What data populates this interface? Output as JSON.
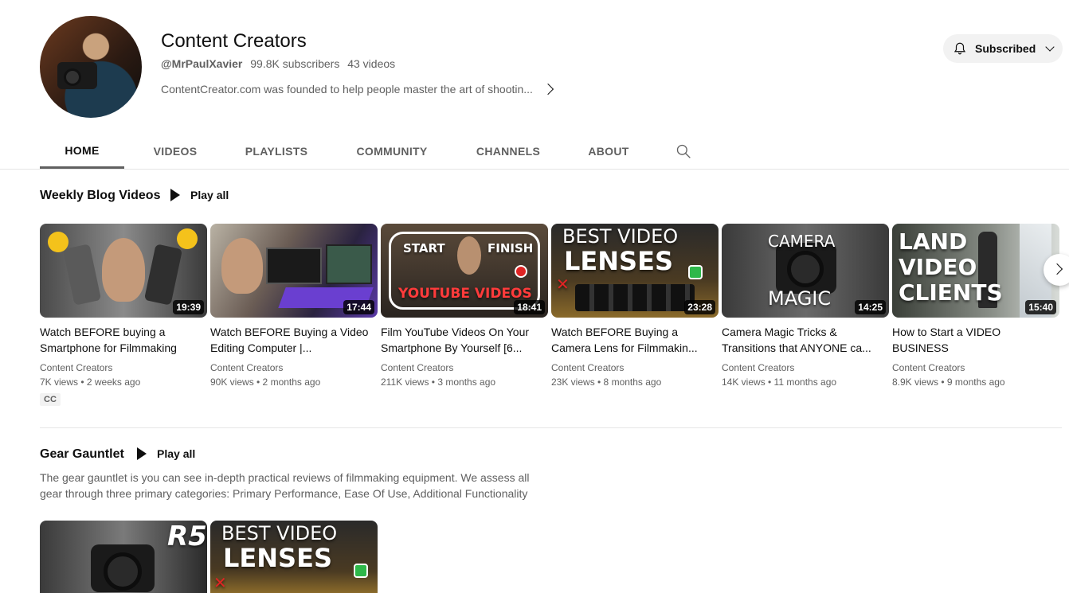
{
  "channel": {
    "title": "Content Creators",
    "handle": "@MrPaulXavier",
    "subscribers": "99.8K subscribers",
    "videos": "43 videos",
    "description": "ContentCreator.com was founded to help people master the art of shootin...",
    "subscribe_label": "Subscribed"
  },
  "tabs": [
    "HOME",
    "VIDEOS",
    "PLAYLISTS",
    "COMMUNITY",
    "CHANNELS",
    "ABOUT"
  ],
  "active_tab": "HOME",
  "shelf1": {
    "title": "Weekly Blog Videos",
    "play_all": "Play all",
    "videos": [
      {
        "title": "Watch BEFORE buying a Smartphone for Filmmaking",
        "channel": "Content Creators",
        "stats": "7K views • 2 weeks ago",
        "duration": "19:39",
        "badge": "CC"
      },
      {
        "title": "Watch BEFORE Buying a Video Editing Computer |...",
        "channel": "Content Creators",
        "stats": "90K views • 2 months ago",
        "duration": "17:44"
      },
      {
        "title": "Film YouTube Videos On Your Smartphone By Yourself [6...",
        "channel": "Content Creators",
        "stats": "211K views • 3 months ago",
        "duration": "18:41",
        "thumb_text": [
          "START",
          "FINISH",
          "YOUTUBE VIDEOS"
        ]
      },
      {
        "title": "Watch BEFORE Buying a Camera Lens for Filmmakin...",
        "channel": "Content Creators",
        "stats": "23K views • 8 months ago",
        "duration": "23:28",
        "thumb_text": [
          "BEST VIDEO",
          "LENSES"
        ]
      },
      {
        "title": "Camera Magic Tricks & Transitions that ANYONE ca...",
        "channel": "Content Creators",
        "stats": "14K views • 11 months ago",
        "duration": "14:25",
        "thumb_text": [
          "CAMERA",
          "MAGIC"
        ]
      },
      {
        "title": "How to Start a VIDEO BUSINESS",
        "channel": "Content Creators",
        "stats": "8.9K views • 9 months ago",
        "duration": "15:40",
        "thumb_text": [
          "LAND",
          "VIDEO",
          "CLIENTS"
        ]
      }
    ]
  },
  "shelf2": {
    "title": "Gear Gauntlet",
    "play_all": "Play all",
    "description": "The gear gauntlet is you can see in-depth practical reviews of filmmaking equipment. We assess all gear through three primary categories: Primary Performance, Ease Of Use, Additional Functionality",
    "thumbs": [
      {
        "thumb_text": [
          "R5"
        ]
      },
      {
        "thumb_text": [
          "BEST VIDEO",
          "LENSES"
        ]
      }
    ]
  }
}
